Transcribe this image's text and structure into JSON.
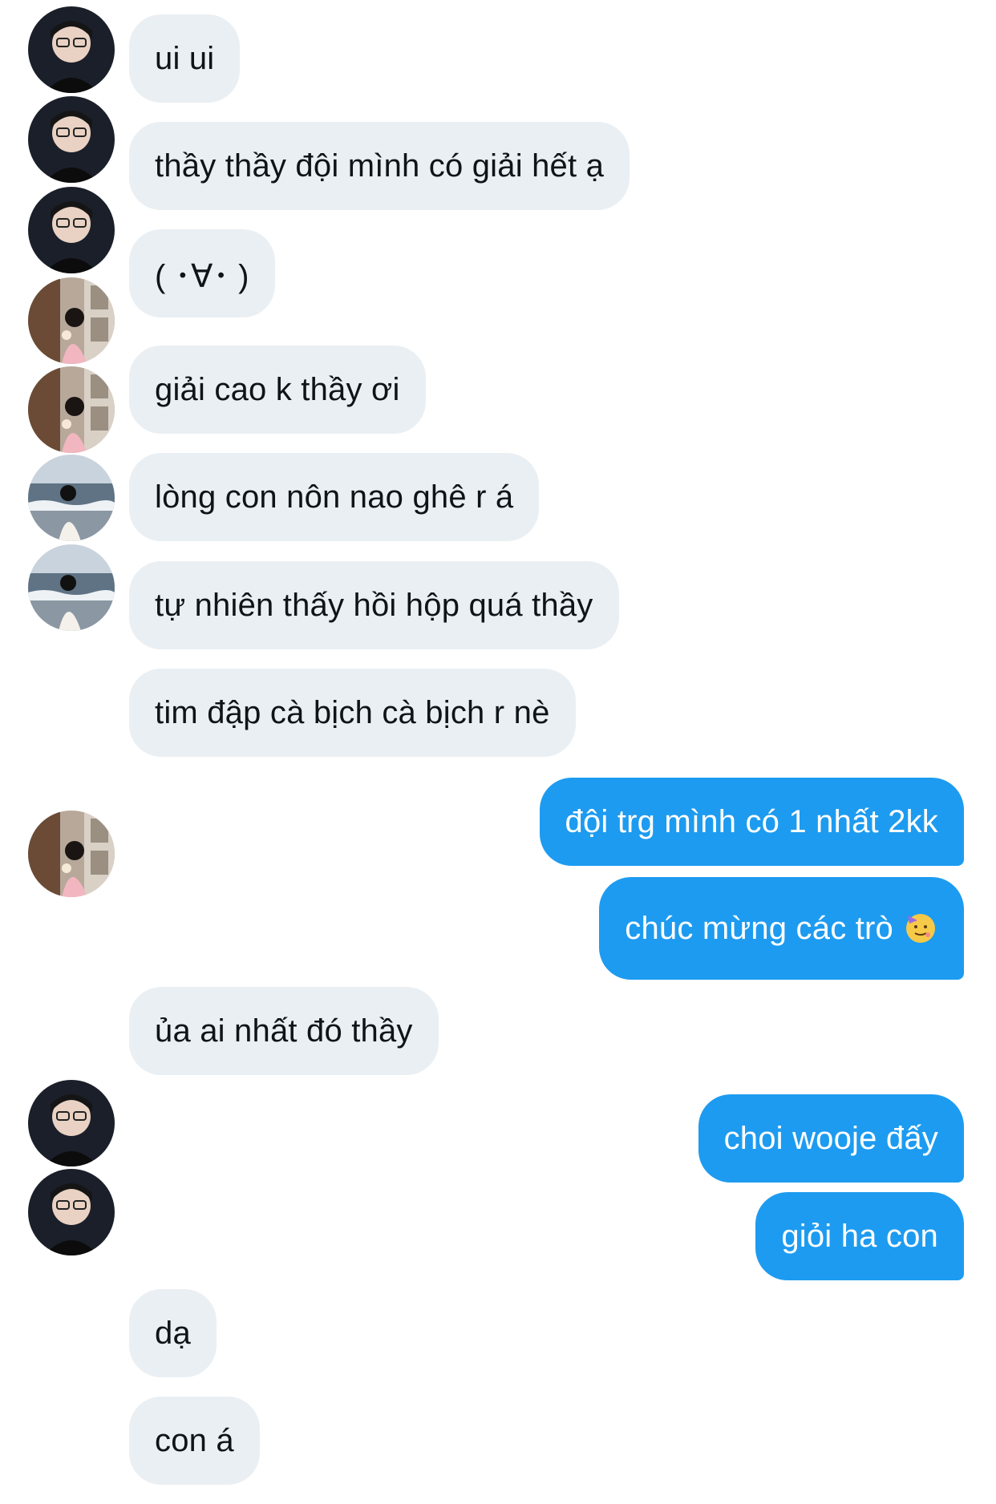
{
  "conversation": {
    "messages": [
      {
        "from": "them",
        "avatar": "avatar-boy",
        "text": "ui ui"
      },
      {
        "from": "them",
        "avatar": "avatar-boy",
        "text": "thầy thầy đội mình có giải hết ạ"
      },
      {
        "from": "them",
        "avatar": "avatar-boy",
        "text": "( ･∀･ )"
      },
      {
        "from": "them",
        "avatar": "avatar-girl-street",
        "text": "giải cao k thầy ơi"
      },
      {
        "from": "them",
        "avatar": "avatar-girl-street",
        "text": "lòng con nôn nao ghê r á"
      },
      {
        "from": "them",
        "avatar": "avatar-girl-beach",
        "text": "tự nhiên thấy hồi hộp quá thầy"
      },
      {
        "from": "them",
        "avatar": "avatar-girl-beach",
        "text": "tim đập cà bịch cà bịch r nè"
      },
      {
        "from": "me",
        "text": "đội trg mình có 1 nhất 2kk"
      },
      {
        "from": "me",
        "text": "chúc mừng các trò",
        "emoji": "partying-face-emoji"
      },
      {
        "from": "them",
        "avatar": "avatar-girl-street",
        "text": "ủa ai nhất đó thầy"
      },
      {
        "from": "me",
        "text": "choi wooje đấy"
      },
      {
        "from": "me",
        "text": "giỏi ha con"
      },
      {
        "from": "them",
        "avatar": "avatar-boy",
        "text": "dạ"
      },
      {
        "from": "them",
        "avatar": "avatar-boy",
        "text": "con á"
      }
    ]
  },
  "colors": {
    "incoming_bubble": "#eaeff3",
    "outgoing_bubble": "#1d9bf0",
    "incoming_text": "#0f1419",
    "outgoing_text": "#ffffff"
  }
}
